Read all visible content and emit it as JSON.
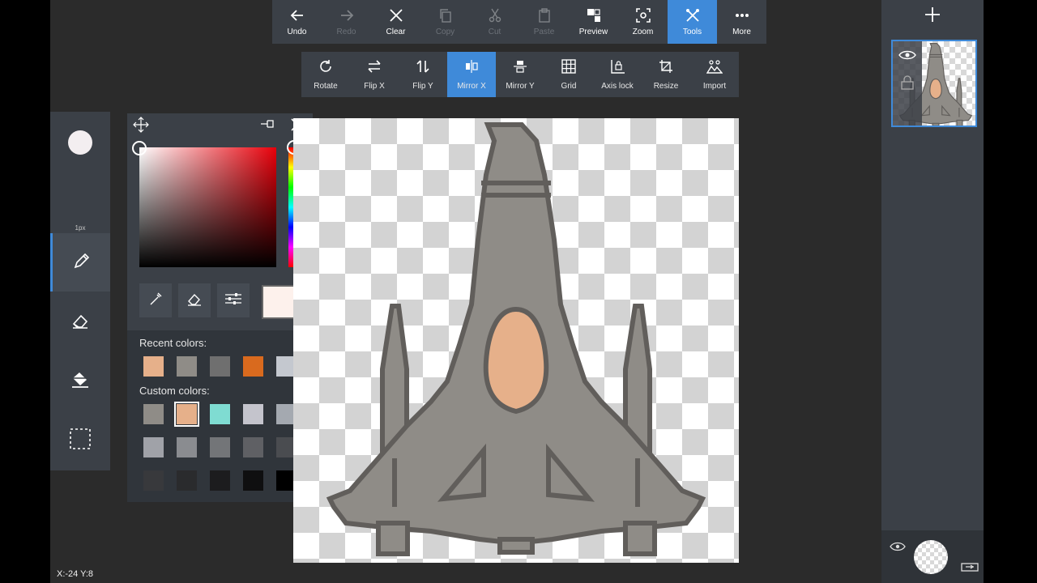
{
  "toolbar": {
    "items": [
      {
        "label": "Undo",
        "icon": "undo-arrow-icon",
        "state": "enabled"
      },
      {
        "label": "Redo",
        "icon": "redo-arrow-icon",
        "state": "disabled"
      },
      {
        "label": "Clear",
        "icon": "x-icon",
        "state": "enabled"
      },
      {
        "label": "Copy",
        "icon": "copy-icon",
        "state": "disabled"
      },
      {
        "label": "Cut",
        "icon": "scissors-icon",
        "state": "disabled"
      },
      {
        "label": "Paste",
        "icon": "paste-icon",
        "state": "disabled"
      },
      {
        "label": "Preview",
        "icon": "preview-icon",
        "state": "enabled"
      },
      {
        "label": "Zoom",
        "icon": "zoom-icon",
        "state": "enabled"
      },
      {
        "label": "Tools",
        "icon": "tools-icon",
        "state": "active"
      },
      {
        "label": "More",
        "icon": "ellipsis-icon",
        "state": "enabled"
      }
    ]
  },
  "subtoolbar": {
    "items": [
      {
        "label": "Rotate",
        "icon": "rotate-icon"
      },
      {
        "label": "Flip X",
        "icon": "flip-x-icon"
      },
      {
        "label": "Flip Y",
        "icon": "flip-y-icon"
      },
      {
        "label": "Mirror X",
        "icon": "mirror-x-icon",
        "active": true
      },
      {
        "label": "Mirror Y",
        "icon": "mirror-y-icon"
      },
      {
        "label": "Grid",
        "icon": "grid-icon"
      },
      {
        "label": "Axis lock",
        "icon": "axis-lock-icon"
      },
      {
        "label": "Resize",
        "icon": "resize-icon"
      },
      {
        "label": "Import",
        "icon": "import-icon"
      }
    ]
  },
  "toolbox": {
    "brush_size_label": "1px",
    "tools": [
      "brush-size",
      "pencil",
      "eraser",
      "fill-bucket",
      "selection"
    ],
    "active_tool": "pencil"
  },
  "color_picker": {
    "recent_label": "Recent colors:",
    "custom_label": "Custom colors:",
    "current_color": "#fdf1ec",
    "hue_color": "#e8000a",
    "recent_colors": [
      "#e6b08a",
      "#8f8c87",
      "#6f6f6f",
      "#d96a1e",
      "#c4c8cf"
    ],
    "custom_colors": [
      [
        "#8f8c87",
        "#e6b08a",
        "#7fdcd2",
        "#c4c4cc",
        "#a4a9b0"
      ],
      [
        "#a0a2a8",
        "#8a8c90",
        "#737578",
        "#5f6064",
        "#4a4c50"
      ],
      [
        "#38393c",
        "#2a2b2d",
        "#1c1c1e",
        "#0f0f10",
        "#000000"
      ]
    ],
    "selected_custom_index": [
      0,
      1
    ]
  },
  "canvas": {
    "colors": {
      "body": "#8f8c87",
      "outline": "#615e5b",
      "cockpit": "#e6b08a"
    }
  },
  "status": {
    "coords": "X:-24 Y:8"
  },
  "layers": {
    "add_icon": "plus-icon",
    "visible_icon": "eye-icon",
    "lock_icon": "lock-icon"
  }
}
